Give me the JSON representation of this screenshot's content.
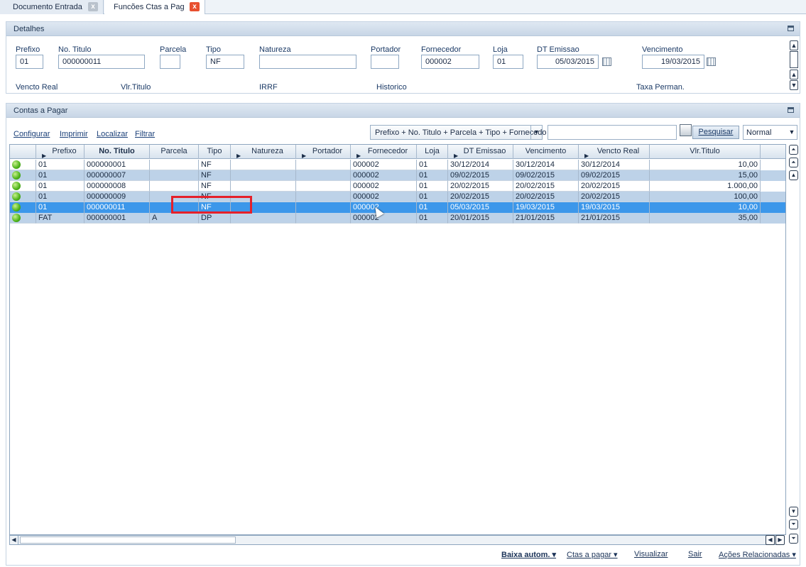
{
  "tabs": [
    {
      "label": "Documento Entrada",
      "close": "x"
    },
    {
      "label": "Funcões Ctas a Pag",
      "close": "x"
    }
  ],
  "detalhes": {
    "title": "Detalhes",
    "fields": {
      "prefixo": {
        "label": "Prefixo",
        "value": "01"
      },
      "no_titulo": {
        "label": "No. Titulo",
        "value": "000000011"
      },
      "parcela": {
        "label": "Parcela",
        "value": ""
      },
      "tipo": {
        "label": "Tipo",
        "value": "NF"
      },
      "natureza": {
        "label": "Natureza",
        "value": ""
      },
      "portador": {
        "label": "Portador",
        "value": ""
      },
      "fornecedor": {
        "label": "Fornecedor",
        "value": "000002"
      },
      "loja": {
        "label": "Loja",
        "value": "01"
      },
      "dt_emissao": {
        "label": "DT Emissao",
        "value": "05/03/2015"
      },
      "vencimento": {
        "label": "Vencimento",
        "value": "19/03/2015"
      }
    },
    "row2_labels": {
      "vencto_real": "Vencto Real",
      "vlr_titulo": "Vlr.Titulo",
      "irrf": "IRRF",
      "historico": "Historico",
      "taxa_perman": "Taxa Perman."
    }
  },
  "contas": {
    "title": "Contas a Pagar",
    "toolbar": {
      "configurar": "Configurar",
      "imprimir": "Imprimir",
      "localizar": "Localizar",
      "filtrar": "Filtrar",
      "index_order": "Prefixo + No. Titulo + Parcela + Tipo + Fornecedo",
      "search_value": "",
      "search_button": "Pesquisar",
      "mode": "Normal"
    },
    "columns": [
      "Prefixo",
      "No. Titulo",
      "Parcela",
      "Tipo",
      "Natureza",
      "Portador",
      "Fornecedor",
      "Loja",
      "DT Emissao",
      "Vencimento",
      "Vencto Real",
      "Vlr.Titulo"
    ],
    "rows": [
      {
        "prefixo": "01",
        "no_titulo": "000000001",
        "parcela": "",
        "tipo": "NF",
        "natureza": "",
        "portador": "",
        "fornecedor": "000002",
        "loja": "01",
        "dt_emissao": "30/12/2014",
        "vencimento": "30/12/2014",
        "vencto_real": "30/12/2014",
        "vlr_titulo": "10,00"
      },
      {
        "prefixo": "01",
        "no_titulo": "000000007",
        "parcela": "",
        "tipo": "NF",
        "natureza": "",
        "portador": "",
        "fornecedor": "000002",
        "loja": "01",
        "dt_emissao": "09/02/2015",
        "vencimento": "09/02/2015",
        "vencto_real": "09/02/2015",
        "vlr_titulo": "15,00"
      },
      {
        "prefixo": "01",
        "no_titulo": "000000008",
        "parcela": "",
        "tipo": "NF",
        "natureza": "",
        "portador": "",
        "fornecedor": "000002",
        "loja": "01",
        "dt_emissao": "20/02/2015",
        "vencimento": "20/02/2015",
        "vencto_real": "20/02/2015",
        "vlr_titulo": "1.000,00"
      },
      {
        "prefixo": "01",
        "no_titulo": "000000009",
        "parcela": "",
        "tipo": "NF",
        "natureza": "",
        "portador": "",
        "fornecedor": "000002",
        "loja": "01",
        "dt_emissao": "20/02/2015",
        "vencimento": "20/02/2015",
        "vencto_real": "20/02/2015",
        "vlr_titulo": "100,00"
      },
      {
        "prefixo": "01",
        "no_titulo": "000000011",
        "parcela": "",
        "tipo": "NF",
        "natureza": "",
        "portador": "",
        "fornecedor": "000002",
        "loja": "01",
        "dt_emissao": "05/03/2015",
        "vencimento": "19/03/2015",
        "vencto_real": "19/03/2015",
        "vlr_titulo": "10,00"
      },
      {
        "prefixo": "FAT",
        "no_titulo": "000000001",
        "parcela": "A",
        "tipo": "DP",
        "natureza": "",
        "portador": "",
        "fornecedor": "000002",
        "loja": "01",
        "dt_emissao": "20/01/2015",
        "vencimento": "21/01/2015",
        "vencto_real": "21/01/2015",
        "vlr_titulo": "35,00"
      }
    ],
    "status_colors": {
      "open": "#4db319",
      "selected_row": "#3c97ea",
      "highlight_box": "#e5202a"
    }
  },
  "footer": {
    "baixa": "Baixa autom.",
    "ctas": "Ctas a pagar",
    "visualizar": "Visualizar",
    "sair": "Sair",
    "acoes": "Ações Relacionadas"
  }
}
